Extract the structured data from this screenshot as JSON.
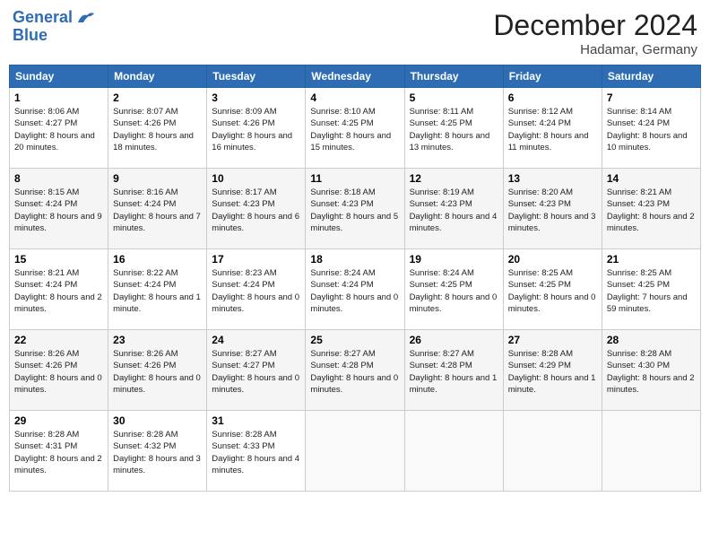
{
  "header": {
    "logo_line1": "General",
    "logo_line2": "Blue",
    "month_title": "December 2024",
    "location": "Hadamar, Germany"
  },
  "weekdays": [
    "Sunday",
    "Monday",
    "Tuesday",
    "Wednesday",
    "Thursday",
    "Friday",
    "Saturday"
  ],
  "weeks": [
    [
      {
        "day": "1",
        "sunrise": "Sunrise: 8:06 AM",
        "sunset": "Sunset: 4:27 PM",
        "daylight": "Daylight: 8 hours and 20 minutes."
      },
      {
        "day": "2",
        "sunrise": "Sunrise: 8:07 AM",
        "sunset": "Sunset: 4:26 PM",
        "daylight": "Daylight: 8 hours and 18 minutes."
      },
      {
        "day": "3",
        "sunrise": "Sunrise: 8:09 AM",
        "sunset": "Sunset: 4:26 PM",
        "daylight": "Daylight: 8 hours and 16 minutes."
      },
      {
        "day": "4",
        "sunrise": "Sunrise: 8:10 AM",
        "sunset": "Sunset: 4:25 PM",
        "daylight": "Daylight: 8 hours and 15 minutes."
      },
      {
        "day": "5",
        "sunrise": "Sunrise: 8:11 AM",
        "sunset": "Sunset: 4:25 PM",
        "daylight": "Daylight: 8 hours and 13 minutes."
      },
      {
        "day": "6",
        "sunrise": "Sunrise: 8:12 AM",
        "sunset": "Sunset: 4:24 PM",
        "daylight": "Daylight: 8 hours and 11 minutes."
      },
      {
        "day": "7",
        "sunrise": "Sunrise: 8:14 AM",
        "sunset": "Sunset: 4:24 PM",
        "daylight": "Daylight: 8 hours and 10 minutes."
      }
    ],
    [
      {
        "day": "8",
        "sunrise": "Sunrise: 8:15 AM",
        "sunset": "Sunset: 4:24 PM",
        "daylight": "Daylight: 8 hours and 9 minutes."
      },
      {
        "day": "9",
        "sunrise": "Sunrise: 8:16 AM",
        "sunset": "Sunset: 4:24 PM",
        "daylight": "Daylight: 8 hours and 7 minutes."
      },
      {
        "day": "10",
        "sunrise": "Sunrise: 8:17 AM",
        "sunset": "Sunset: 4:23 PM",
        "daylight": "Daylight: 8 hours and 6 minutes."
      },
      {
        "day": "11",
        "sunrise": "Sunrise: 8:18 AM",
        "sunset": "Sunset: 4:23 PM",
        "daylight": "Daylight: 8 hours and 5 minutes."
      },
      {
        "day": "12",
        "sunrise": "Sunrise: 8:19 AM",
        "sunset": "Sunset: 4:23 PM",
        "daylight": "Daylight: 8 hours and 4 minutes."
      },
      {
        "day": "13",
        "sunrise": "Sunrise: 8:20 AM",
        "sunset": "Sunset: 4:23 PM",
        "daylight": "Daylight: 8 hours and 3 minutes."
      },
      {
        "day": "14",
        "sunrise": "Sunrise: 8:21 AM",
        "sunset": "Sunset: 4:23 PM",
        "daylight": "Daylight: 8 hours and 2 minutes."
      }
    ],
    [
      {
        "day": "15",
        "sunrise": "Sunrise: 8:21 AM",
        "sunset": "Sunset: 4:24 PM",
        "daylight": "Daylight: 8 hours and 2 minutes."
      },
      {
        "day": "16",
        "sunrise": "Sunrise: 8:22 AM",
        "sunset": "Sunset: 4:24 PM",
        "daylight": "Daylight: 8 hours and 1 minute."
      },
      {
        "day": "17",
        "sunrise": "Sunrise: 8:23 AM",
        "sunset": "Sunset: 4:24 PM",
        "daylight": "Daylight: 8 hours and 0 minutes."
      },
      {
        "day": "18",
        "sunrise": "Sunrise: 8:24 AM",
        "sunset": "Sunset: 4:24 PM",
        "daylight": "Daylight: 8 hours and 0 minutes."
      },
      {
        "day": "19",
        "sunrise": "Sunrise: 8:24 AM",
        "sunset": "Sunset: 4:25 PM",
        "daylight": "Daylight: 8 hours and 0 minutes."
      },
      {
        "day": "20",
        "sunrise": "Sunrise: 8:25 AM",
        "sunset": "Sunset: 4:25 PM",
        "daylight": "Daylight: 8 hours and 0 minutes."
      },
      {
        "day": "21",
        "sunrise": "Sunrise: 8:25 AM",
        "sunset": "Sunset: 4:25 PM",
        "daylight": "Daylight: 7 hours and 59 minutes."
      }
    ],
    [
      {
        "day": "22",
        "sunrise": "Sunrise: 8:26 AM",
        "sunset": "Sunset: 4:26 PM",
        "daylight": "Daylight: 8 hours and 0 minutes."
      },
      {
        "day": "23",
        "sunrise": "Sunrise: 8:26 AM",
        "sunset": "Sunset: 4:26 PM",
        "daylight": "Daylight: 8 hours and 0 minutes."
      },
      {
        "day": "24",
        "sunrise": "Sunrise: 8:27 AM",
        "sunset": "Sunset: 4:27 PM",
        "daylight": "Daylight: 8 hours and 0 minutes."
      },
      {
        "day": "25",
        "sunrise": "Sunrise: 8:27 AM",
        "sunset": "Sunset: 4:28 PM",
        "daylight": "Daylight: 8 hours and 0 minutes."
      },
      {
        "day": "26",
        "sunrise": "Sunrise: 8:27 AM",
        "sunset": "Sunset: 4:28 PM",
        "daylight": "Daylight: 8 hours and 1 minute."
      },
      {
        "day": "27",
        "sunrise": "Sunrise: 8:28 AM",
        "sunset": "Sunset: 4:29 PM",
        "daylight": "Daylight: 8 hours and 1 minute."
      },
      {
        "day": "28",
        "sunrise": "Sunrise: 8:28 AM",
        "sunset": "Sunset: 4:30 PM",
        "daylight": "Daylight: 8 hours and 2 minutes."
      }
    ],
    [
      {
        "day": "29",
        "sunrise": "Sunrise: 8:28 AM",
        "sunset": "Sunset: 4:31 PM",
        "daylight": "Daylight: 8 hours and 2 minutes."
      },
      {
        "day": "30",
        "sunrise": "Sunrise: 8:28 AM",
        "sunset": "Sunset: 4:32 PM",
        "daylight": "Daylight: 8 hours and 3 minutes."
      },
      {
        "day": "31",
        "sunrise": "Sunrise: 8:28 AM",
        "sunset": "Sunset: 4:33 PM",
        "daylight": "Daylight: 8 hours and 4 minutes."
      },
      null,
      null,
      null,
      null
    ]
  ]
}
